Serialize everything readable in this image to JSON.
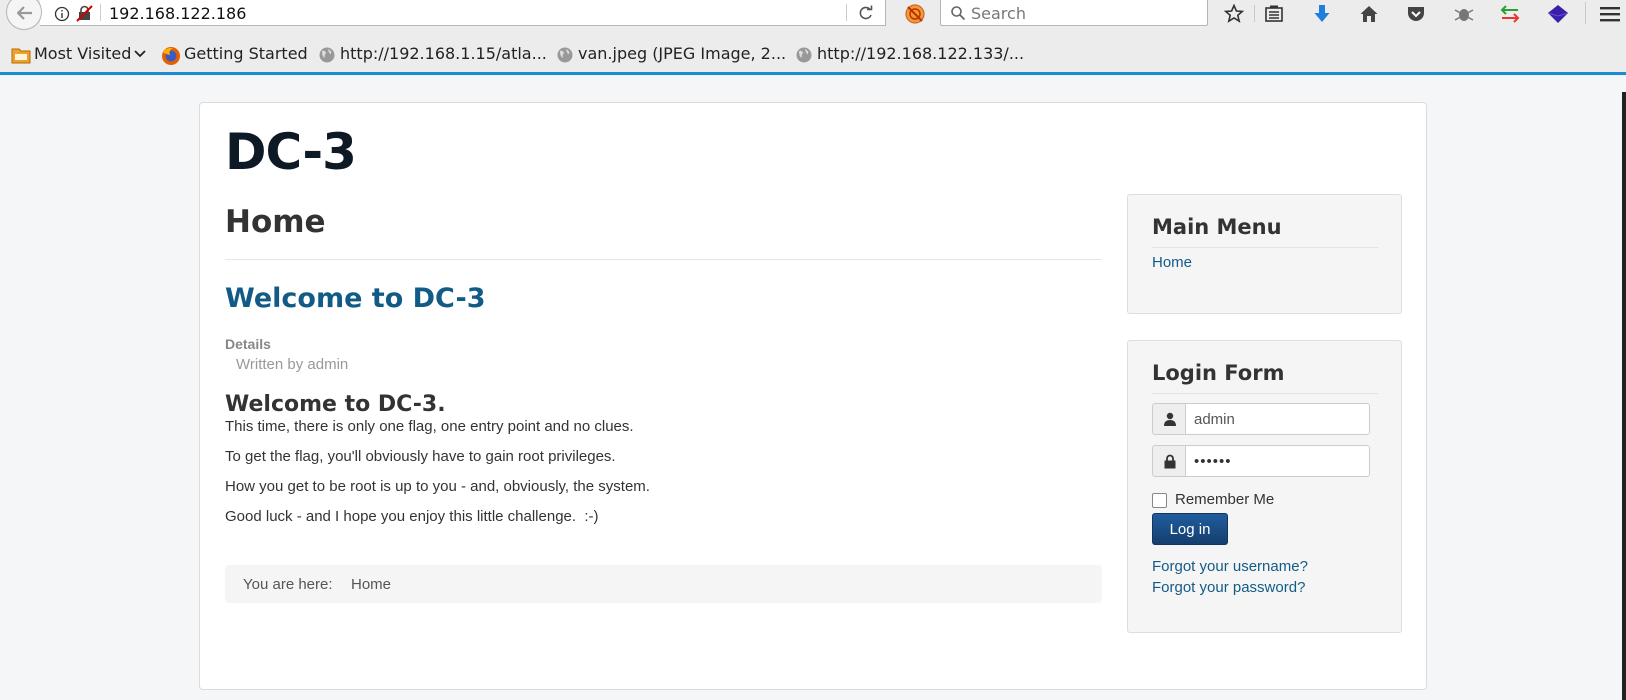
{
  "browser": {
    "url": "192.168.122.186",
    "search_placeholder": "Search",
    "toolbar_icons": [
      "bookmark-star-icon",
      "reading-list-icon",
      "downloads-icon",
      "home-icon",
      "pocket-icon",
      "bug-extension-icon",
      "switch-extension-icon",
      "cube-extension-icon",
      "hamburger-menu-icon"
    ],
    "bookmarks": [
      {
        "label": "Most Visited",
        "icon": "folder-icon"
      },
      {
        "label": "Getting Started",
        "icon": "firefox-icon"
      },
      {
        "label": "http://192.168.1.15/atla...",
        "icon": "globe-icon"
      },
      {
        "label": "van.jpeg (JPEG Image, 2...",
        "icon": "globe-icon"
      },
      {
        "label": "http://192.168.122.133/...",
        "icon": "globe-icon"
      }
    ],
    "accent_color": "#1b8bd3"
  },
  "site": {
    "title": "DC-3"
  },
  "main": {
    "page_heading": "Home",
    "article": {
      "title": "Welcome to DC-3",
      "details_label": "Details",
      "author_line": "Written by admin",
      "subtitle": "Welcome to DC-3.",
      "paragraphs": [
        "This time, there is only one flag, one entry point and no clues.",
        "To get the flag, you'll obviously have to gain root privileges.",
        "How you get to be root is up to you - and, obviously, the system.",
        "Good luck - and I hope you enjoy this little challenge.  :-)"
      ]
    },
    "breadcrumb": {
      "label": "You are here:",
      "current": "Home"
    }
  },
  "sidebar": {
    "main_menu": {
      "title": "Main Menu",
      "items": [
        "Home"
      ]
    },
    "login_form": {
      "title": "Login Form",
      "username_value": "admin",
      "password_value": "••••••",
      "remember_label": "Remember Me",
      "remember_checked": false,
      "login_button": "Log in",
      "forgot_username": "Forgot your username?",
      "forgot_password": "Forgot your password?"
    },
    "link_color": "#135b87",
    "button_color": "#1a4f8a"
  }
}
